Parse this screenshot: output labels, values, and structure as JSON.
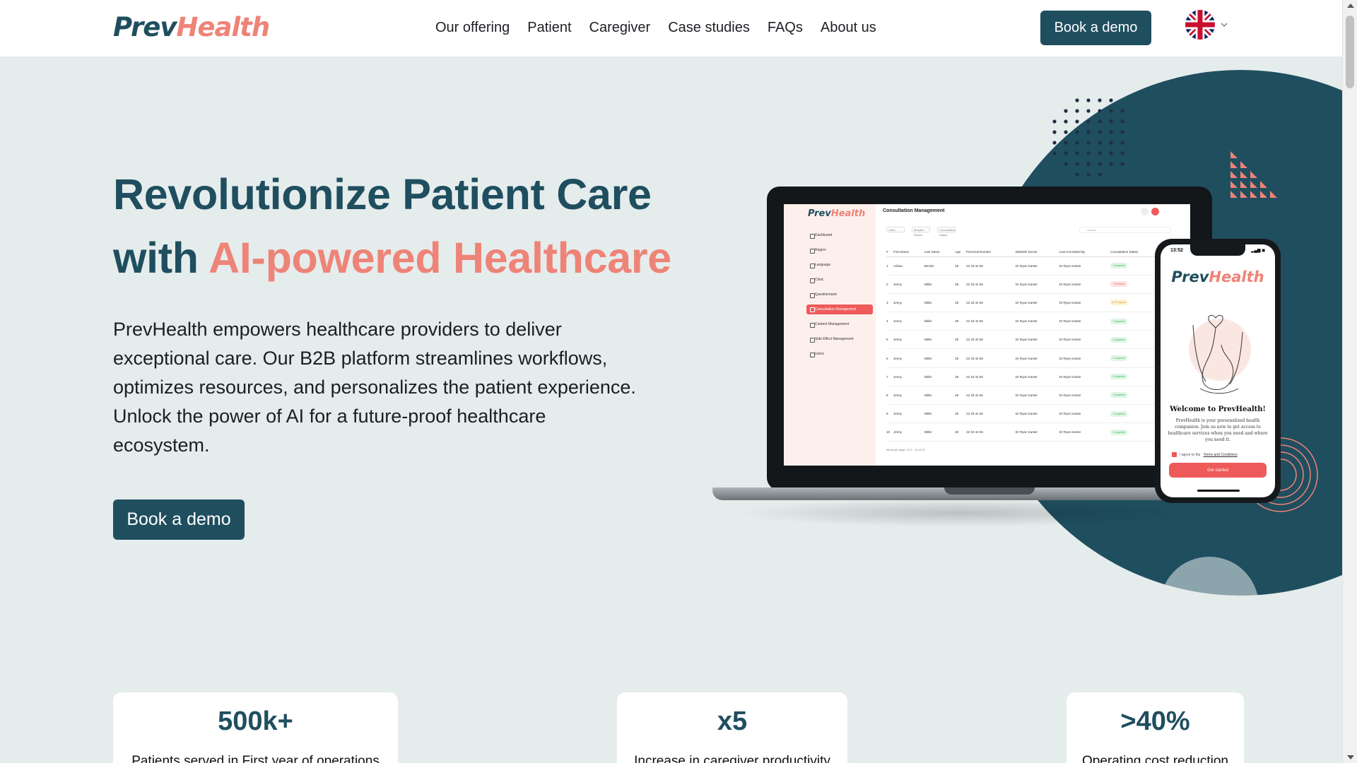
{
  "header": {
    "logo_prev": "Prev",
    "logo_health": "Health",
    "nav": [
      "Our offering",
      "Patient",
      "Caregiver",
      "Case studies",
      "FAQs",
      "About us"
    ],
    "book_demo": "Book a demo",
    "language_icon": "uk-flag-icon"
  },
  "hero": {
    "title_line1": "Revolutionize Patient Care",
    "title_line2_prefix": "with ",
    "title_line2_accent": "AI-powered Healthcare",
    "description": "PrevHealth empowers healthcare providers to deliver exceptional care. Our B2B platform streamlines workflows, optimizes resources, and personalizes the patient experience. Unlock the power of AI for a future-proof healthcare ecosystem.",
    "cta": "Book a demo"
  },
  "laptop_app": {
    "logo_prev": "Prev",
    "logo_health": "Health",
    "page_title": "Consultation Management",
    "menu": [
      "Dashboard",
      "Region",
      "Language",
      "Clinic",
      "Questionnaire",
      "Consultation Management",
      "Content Management",
      "Side Effect Management",
      "Users"
    ],
    "active_menu": "Consultation Management",
    "filters": [
      "Clinic",
      "Midwife/ Doctor",
      "Consultation Status"
    ],
    "search_placeholder": "Search",
    "columns": [
      "#",
      "First Name",
      "Last Name",
      "Age",
      "Personal Number",
      "Midwife/ Doctor",
      "Last Consulted By",
      "Consultation Status",
      "Action"
    ],
    "rows": [
      [
        "1",
        "Adrian",
        "Becker",
        "28",
        "22 33 44 55",
        "Dr Ryan Kanter",
        "Dr Ryan Kanter",
        "Complete"
      ],
      [
        "2",
        "Jenny",
        "Miller",
        "28",
        "22 33 44 55",
        "Dr Ryan Kanter",
        "Dr Ryan Kanter",
        "Pending"
      ],
      [
        "3",
        "Jenny",
        "Miller",
        "28",
        "22 33 44 55",
        "Dr Ryan Kanter",
        "Dr Ryan Kanter",
        "In Progress"
      ],
      [
        "4",
        "Jenny",
        "Miller",
        "28",
        "22 33 44 55",
        "Dr Ryan Kanter",
        "Dr Ryan Kanter",
        "Complete"
      ],
      [
        "5",
        "Jenny",
        "Miller",
        "28",
        "22 33 44 55",
        "Dr Ryan Kanter",
        "Dr Ryan Kanter",
        "Complete"
      ],
      [
        "6",
        "Jenny",
        "Miller",
        "28",
        "22 33 44 55",
        "Dr Ryan Kanter",
        "Dr Ryan Kanter",
        "Complete"
      ],
      [
        "7",
        "Jenny",
        "Miller",
        "28",
        "22 33 44 55",
        "Dr Ryan Kanter",
        "Dr Ryan Kanter",
        "Complete"
      ],
      [
        "8",
        "Jenny",
        "Miller",
        "28",
        "22 33 44 55",
        "Dr Ryan Kanter",
        "Dr Ryan Kanter",
        "Complete"
      ],
      [
        "9",
        "Jenny",
        "Miller",
        "28",
        "22 33 44 55",
        "Dr Ryan Kanter",
        "Dr Ryan Kanter",
        "Complete"
      ],
      [
        "10",
        "Jenny",
        "Miller",
        "28",
        "22 33 44 55",
        "Dr Ryan Kanter",
        "Dr Ryan Kanter",
        "Complete"
      ]
    ],
    "footer": "Items per page: 10   1 - 10 of 20"
  },
  "phone_app": {
    "time": "13:52",
    "logo_prev": "Prev",
    "logo_health": "Health",
    "welcome": "Welcome to PrevHealth!",
    "text": "PrevHealth is your personalized health companion. Join us now to get access to healthcare services when you need and where you need it.",
    "agree": "I agree to the",
    "terms": "Terms and Conditions",
    "button": "Get started"
  },
  "stats": [
    {
      "value": "500k+",
      "label": "Patients served in First year of operations"
    },
    {
      "value": "x5",
      "label": "Increase in caregiver productivity"
    },
    {
      "value": ">40%",
      "label": "Operating cost reduction"
    }
  ],
  "colors": {
    "brand_teal": "#1f4e5f",
    "brand_coral": "#ee8377",
    "background": "#e5ecec",
    "app_red": "#ee5a5a"
  }
}
